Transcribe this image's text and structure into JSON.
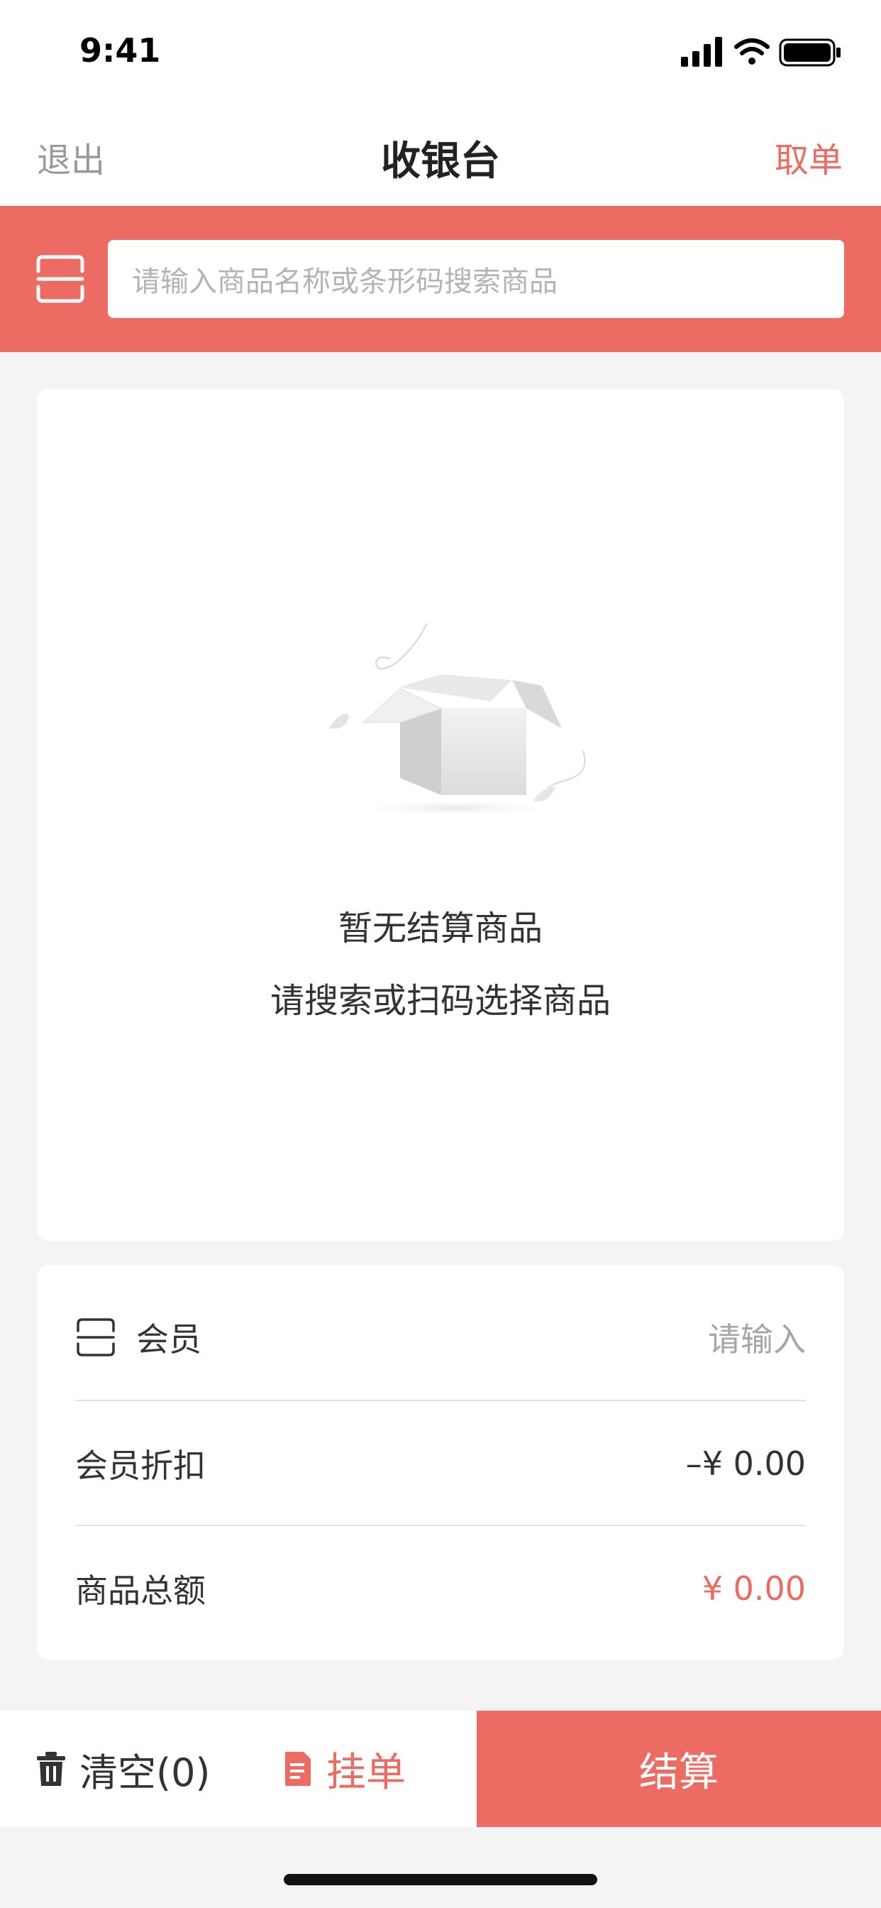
{
  "status_bar": {
    "time": "9:41"
  },
  "nav": {
    "left": "退出",
    "title": "收银台",
    "right": "取单"
  },
  "search": {
    "placeholder": "请输入商品名称或条形码搜索商品"
  },
  "empty": {
    "title": "暂无结算商品",
    "subtitle": "请搜索或扫码选择商品"
  },
  "summary": {
    "member_label": "会员",
    "member_placeholder": "请输入",
    "discount_label": "会员折扣",
    "discount_value": "–¥ 0.00",
    "total_label": "商品总额",
    "total_value": "¥ 0.00"
  },
  "bottom": {
    "clear": "清空(0)",
    "hold": "挂单",
    "checkout": "结算"
  },
  "colors": {
    "accent": "#ec6b62",
    "background": "#f4f4f4"
  },
  "icons": {
    "scan": "scan-icon",
    "member": "member-card-icon",
    "clear": "trash-icon",
    "hold": "document-icon",
    "empty": "empty-box-icon"
  }
}
